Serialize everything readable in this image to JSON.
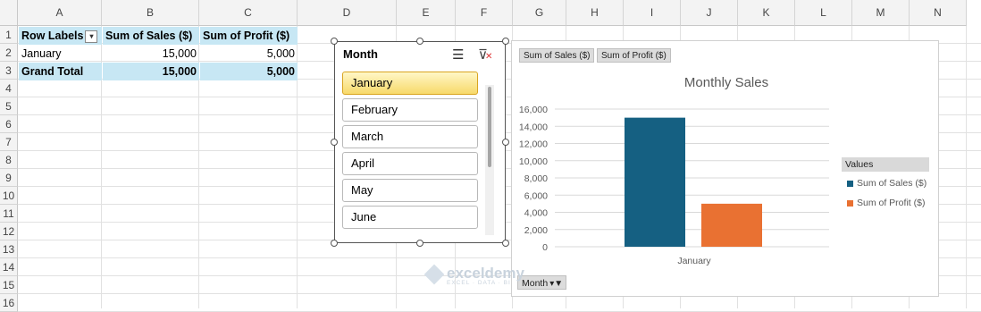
{
  "columns": [
    "A",
    "B",
    "C",
    "D",
    "E",
    "F",
    "G",
    "H",
    "I",
    "J",
    "K",
    "L",
    "M",
    "N"
  ],
  "rows": [
    "1",
    "2",
    "3",
    "4",
    "5",
    "6",
    "7",
    "8",
    "9",
    "10",
    "11",
    "12",
    "13",
    "14",
    "15",
    "16"
  ],
  "pivot": {
    "header": {
      "row_labels": "Row Labels",
      "sales": "Sum of Sales ($)",
      "profit": "Sum of Profit ($)"
    },
    "data_row": {
      "label": "January",
      "sales": "15,000",
      "profit": "5,000"
    },
    "total_row": {
      "label": "Grand Total",
      "sales": "15,000",
      "profit": "5,000"
    }
  },
  "slicer": {
    "title": "Month",
    "items": [
      "January",
      "February",
      "March",
      "April",
      "May",
      "June"
    ],
    "selected": "January"
  },
  "chart": {
    "field_buttons": [
      "Sum of Sales ($)",
      "Sum of Profit ($)"
    ],
    "legend_title": "Values",
    "axis_field_button": "Month",
    "colors": {
      "sales": "#156082",
      "profit": "#e97132"
    }
  },
  "chart_data": {
    "type": "bar",
    "title": "Monthly Sales",
    "categories": [
      "January"
    ],
    "series": [
      {
        "name": "Sum of Sales ($)",
        "values": [
          15000
        ]
      },
      {
        "name": "Sum of Profit ($)",
        "values": [
          5000
        ]
      }
    ],
    "ylim": [
      0,
      16000
    ],
    "yticks": [
      "0",
      "2,000",
      "4,000",
      "6,000",
      "8,000",
      "10,000",
      "12,000",
      "14,000",
      "16,000"
    ],
    "legend": "right",
    "grid": true
  },
  "watermark": {
    "brand": "exceldemy",
    "tagline": "EXCEL · DATA · BI"
  }
}
